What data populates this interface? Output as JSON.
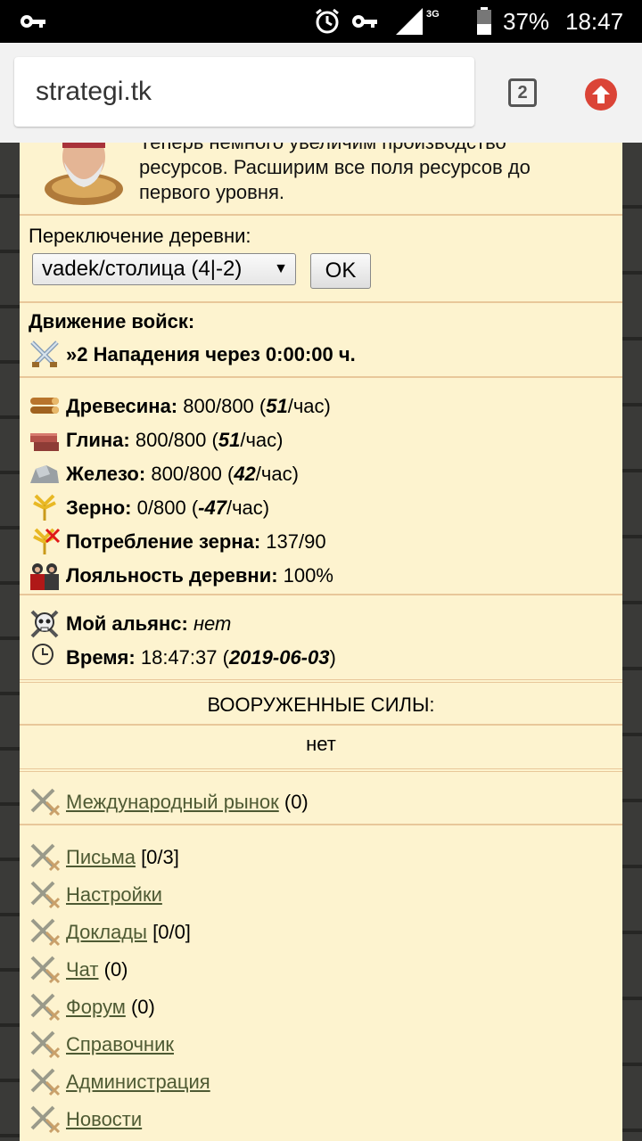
{
  "status_bar": {
    "battery": "37%",
    "time": "18:47",
    "network": "3G"
  },
  "browser": {
    "url": "strategi.tk",
    "tab_count": "2"
  },
  "tutorial": {
    "text_line0": "Теперь немного увеличим производство",
    "text_line1": "ресурсов. Расширим все поля ресурсов до",
    "text_line2": "первого уровня."
  },
  "village": {
    "label": "Переключение деревни:",
    "selected": "vadek/столица (4|-2)",
    "ok": "OK"
  },
  "troops": {
    "title": "Движение войск:",
    "attack": "»2 Нападения через 0:00:00 ч."
  },
  "resources": [
    {
      "icon": "wood-icon",
      "label": "Древесина:",
      "value": "800/800",
      "rate_open": "(",
      "rate": "51",
      "rate_close": "/час)"
    },
    {
      "icon": "clay-icon",
      "label": "Глина:",
      "value": "800/800",
      "rate_open": "(",
      "rate": "51",
      "rate_close": "/час)"
    },
    {
      "icon": "iron-icon",
      "label": "Железо:",
      "value": "800/800",
      "rate_open": "(",
      "rate": "42",
      "rate_close": "/час)"
    },
    {
      "icon": "grain-icon",
      "label": "Зерно:",
      "value": "0/800",
      "rate_open": "(",
      "rate": "-47",
      "rate_close": "/час)"
    }
  ],
  "consumption": {
    "label": "Потребление зерна:",
    "value": "137/90"
  },
  "loyalty": {
    "label": "Лояльность деревни:",
    "value": "100%"
  },
  "alliance": {
    "label": "Мой альянс:",
    "value": "нет"
  },
  "time_info": {
    "label": "Время:",
    "value": "18:47:37",
    "open": "(",
    "date": "2019-06-03",
    "close": ")"
  },
  "forces": {
    "title": "ВООРУЖЕННЫЕ СИЛЫ:",
    "value": "нет"
  },
  "market": {
    "label": "Международный рынок",
    "count": "(0)"
  },
  "links": [
    {
      "label": "Письма",
      "count": "[0/3]"
    },
    {
      "label": "Настройки",
      "count": ""
    },
    {
      "label": "Доклады",
      "count": "[0/0]"
    },
    {
      "label": "Чат",
      "count": "(0)"
    },
    {
      "label": "Форум",
      "count": "(0)"
    },
    {
      "label": "Справочник",
      "count": ""
    },
    {
      "label": "Администрация",
      "count": ""
    },
    {
      "label": "Новости",
      "count": ""
    }
  ],
  "colors": {
    "panel_bg": "#fdf3cf",
    "divider": "#e8c79a",
    "link": "#4e5a33",
    "update_red": "#db4437"
  }
}
